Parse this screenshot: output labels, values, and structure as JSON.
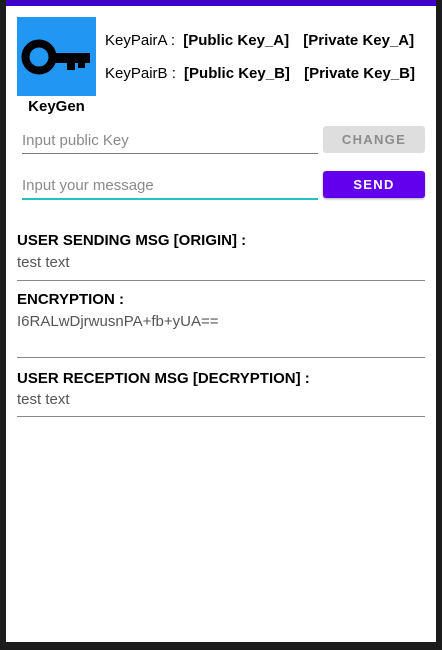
{
  "app": {
    "name": "KeyGen",
    "logo_icon": "key-icon",
    "accent_color": "#6200ee",
    "status_bar_color": "#3f00c8",
    "logo_bg_color": "#2196f3"
  },
  "keypairs": {
    "a": {
      "label": "KeyPairA :",
      "public_key": "[Public Key_A]",
      "private_key": "[Private Key_A]"
    },
    "b": {
      "label": "KeyPairB :",
      "public_key": "[Public Key_B]",
      "private_key": "[Private Key_B]"
    }
  },
  "public_key_input": {
    "placeholder": "Input public Key",
    "value": "",
    "button_label": "CHANGE"
  },
  "message_input": {
    "placeholder": "Input your message",
    "value": "",
    "button_label": "SEND"
  },
  "sections": {
    "origin": {
      "title": "USER SENDING MSG [ORIGIN]  :",
      "value": "test text"
    },
    "encryption": {
      "title": "ENCRYPTION  :",
      "value": "I6RALwDjrwusnPA+fb+yUA=="
    },
    "decryption": {
      "title": "USER RECEPTION MSG [DECRYPTION]  :",
      "value": "test text"
    }
  }
}
